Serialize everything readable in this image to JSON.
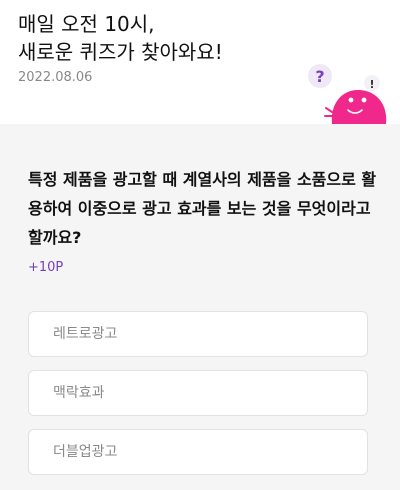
{
  "header": {
    "headline_line1": "매일 오전 10시,",
    "headline_line2": "새로운 퀴즈가 찾아와요!",
    "date": "2022.08.06",
    "mascot_icons": [
      "question-mark-icon",
      "exclamation-mark-icon"
    ]
  },
  "quiz": {
    "question": "특정 제품을 광고할 때 계열사의 제품을 소품으로 활용하여 이중으로 광고 효과를 보는 것을 무엇이라고 할까요?",
    "reward": "+10P",
    "options": [
      {
        "label": "레트로광고"
      },
      {
        "label": "맥락효과"
      },
      {
        "label": "더블업광고"
      }
    ]
  },
  "colors": {
    "accent": "#7a3fbf",
    "mascot": "#f0288c",
    "background_gray": "#f5f5f5"
  }
}
